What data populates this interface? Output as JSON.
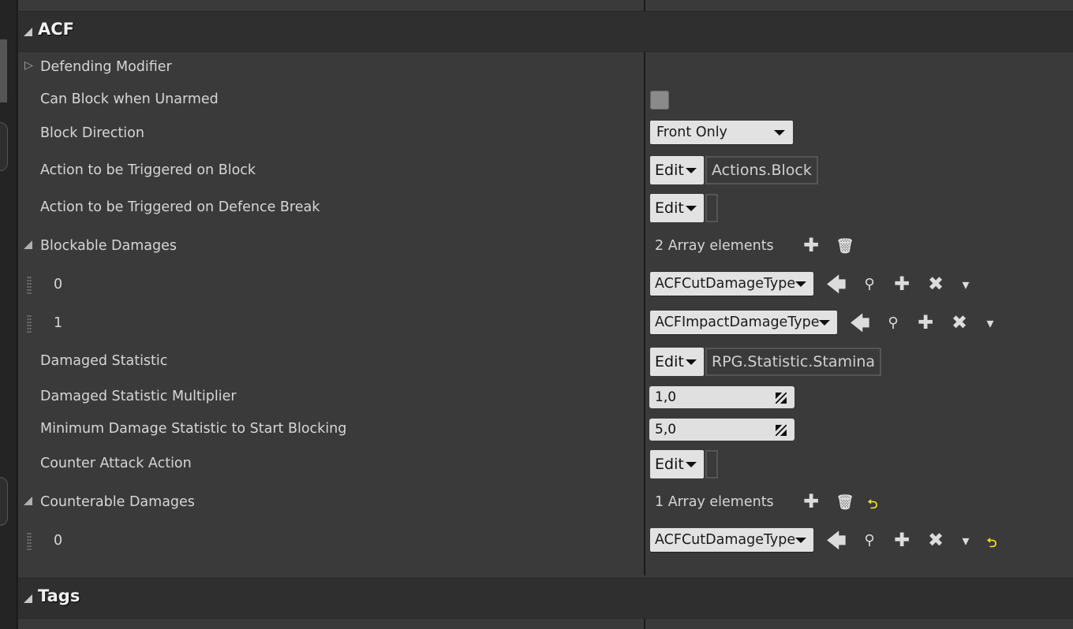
{
  "categories": {
    "acf": "ACF",
    "tags": "Tags"
  },
  "rows": {
    "defending_modifier": "Defending Modifier",
    "can_block_unarmed": "Can Block when Unarmed",
    "block_direction": "Block Direction",
    "action_on_block": "Action to be Triggered on Block",
    "action_on_defence_break": "Action to be Triggered on Defence Break",
    "blockable_damages": "Blockable Damages",
    "damaged_statistic": "Damaged Statistic",
    "damaged_statistic_multiplier": "Damaged Statistic Multiplier",
    "min_damage_statistic": "Minimum Damage Statistic to Start Blocking",
    "counter_attack_action": "Counter Attack Action",
    "counterable_damages": "Counterable Damages"
  },
  "values": {
    "can_block_unarmed_checked": false,
    "block_direction": "Front Only",
    "edit_label": "Edit",
    "action_on_block_tag": "Actions.Block",
    "action_on_defence_break_tag": "",
    "blockable_count": "2 Array elements",
    "blockable_items": [
      {
        "index": "0",
        "type": "ACFCutDamageType"
      },
      {
        "index": "1",
        "type": "ACFImpactDamageType"
      }
    ],
    "damaged_statistic_tag": "RPG.Statistic.Stamina",
    "damaged_statistic_multiplier": "1,0",
    "min_damage_statistic": "5,0",
    "counter_attack_tag": "",
    "counterable_count": "1 Array elements",
    "counterable_items": [
      {
        "index": "0",
        "type": "ACFCutDamageType"
      }
    ]
  },
  "icons": {
    "add": "plus-icon",
    "delete": "trash-icon",
    "reset": "reset-to-default-icon",
    "use_selected": "arrow-left-icon",
    "browse": "magnifier-icon",
    "insert": "plus-icon",
    "remove": "x-icon",
    "more": "chevron-down-icon"
  },
  "colors": {
    "background": "#3a3a3a",
    "header": "#2f2f2f",
    "widget": "#e2e2e2",
    "reset_icon": "#e8e020"
  }
}
